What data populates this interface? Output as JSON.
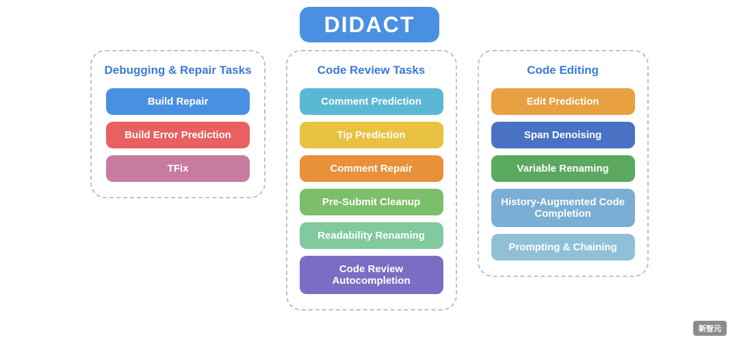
{
  "title": "DIDACT",
  "columns": [
    {
      "id": "debugging",
      "title": "Debugging & Repair\nTasks",
      "tasks": [
        {
          "label": "Build Repair",
          "color": "btn-blue"
        },
        {
          "label": "Build Error Prediction",
          "color": "btn-red"
        },
        {
          "label": "TFix",
          "color": "btn-pink"
        }
      ]
    },
    {
      "id": "code-review",
      "title": "Code Review Tasks",
      "tasks": [
        {
          "label": "Comment Prediction",
          "color": "btn-skyblue"
        },
        {
          "label": "Tip Prediction",
          "color": "btn-yellow"
        },
        {
          "label": "Comment Repair",
          "color": "btn-orange"
        },
        {
          "label": "Pre-Submit Cleanup",
          "color": "btn-green"
        },
        {
          "label": "Readability Renaming",
          "color": "btn-teal"
        },
        {
          "label": "Code Review\nAutocompletion",
          "color": "btn-purple"
        }
      ]
    },
    {
      "id": "code-editing",
      "title": "Code Editing",
      "tasks": [
        {
          "label": "Edit Prediction",
          "color": "btn-amber"
        },
        {
          "label": "Span Denoising",
          "color": "btn-darkblue"
        },
        {
          "label": "Variable Renaming",
          "color": "btn-medgreen"
        },
        {
          "label": "History-Augmented\nCode Completion",
          "color": "btn-lightblue"
        },
        {
          "label": "Prompting & Chaining",
          "color": "btn-paleblue"
        }
      ]
    }
  ],
  "watermark": "新智元"
}
